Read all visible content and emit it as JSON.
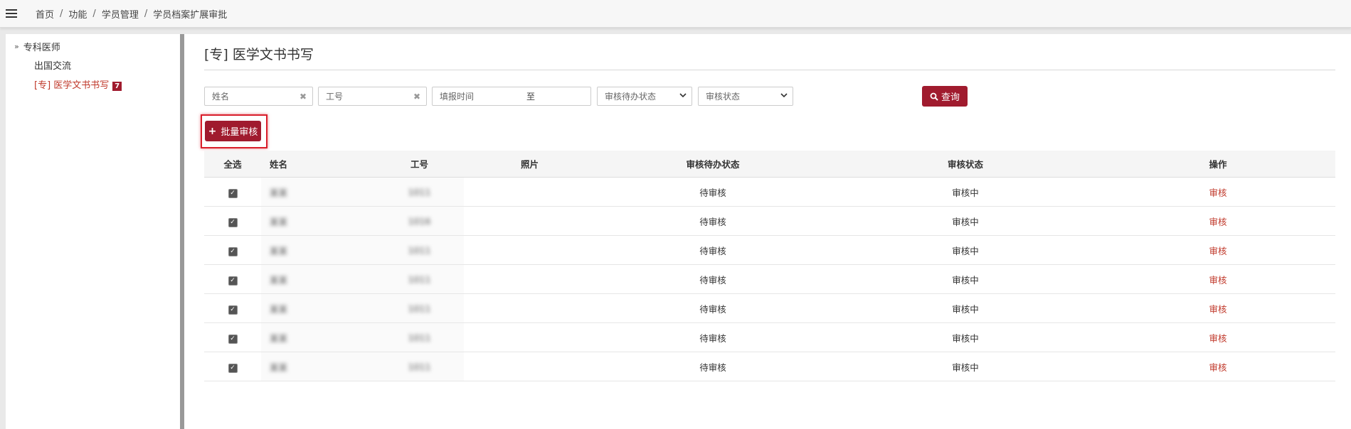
{
  "breadcrumb": [
    "首页",
    "功能",
    "学员管理",
    "学员档案扩展审批"
  ],
  "sidebar": {
    "root_label": "专科医师",
    "items": [
      {
        "label": "出国交流"
      },
      {
        "label": "[专] 医学文书书写",
        "badge": "7"
      }
    ]
  },
  "page_title": "[专] 医学文书书写",
  "filters": {
    "name_placeholder": "姓名",
    "id_placeholder": "工号",
    "date_placeholder": "填报时间",
    "date_sep": "至",
    "pending_status": "审核待办状态",
    "audit_status": "审核状态",
    "query_label": "查询"
  },
  "batch_label": "批量审核",
  "table": {
    "headers": [
      "全选",
      "姓名",
      "工号",
      "照片",
      "审核待办状态",
      "审核状态",
      "操作"
    ],
    "rows": [
      {
        "name": "某某",
        "id": "1011",
        "pending": "待审核",
        "status": "审核中",
        "op": "审核"
      },
      {
        "name": "某某",
        "id": "1016",
        "pending": "待审核",
        "status": "审核中",
        "op": "审核"
      },
      {
        "name": "某某",
        "id": "1011",
        "pending": "待审核",
        "status": "审核中",
        "op": "审核"
      },
      {
        "name": "某某",
        "id": "1011",
        "pending": "待审核",
        "status": "审核中",
        "op": "审核"
      },
      {
        "name": "某某",
        "id": "1011",
        "pending": "待审核",
        "status": "审核中",
        "op": "审核"
      },
      {
        "name": "某某",
        "id": "1011",
        "pending": "待审核",
        "status": "审核中",
        "op": "审核"
      },
      {
        "name": "某某",
        "id": "1011",
        "pending": "待审核",
        "status": "审核中",
        "op": "审核"
      }
    ]
  },
  "colors": {
    "accent": "#a01b2e",
    "link": "#c0392b",
    "highlight": "#d91e2b"
  }
}
